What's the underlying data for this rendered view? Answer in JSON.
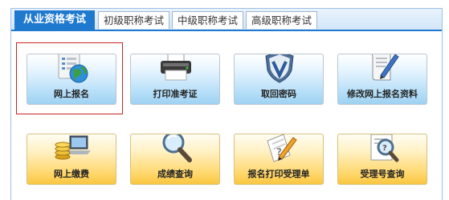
{
  "tabs": [
    {
      "label": "从业资格考试",
      "active": true
    },
    {
      "label": "初级职称考试",
      "active": false
    },
    {
      "label": "中级职称考试",
      "active": false
    },
    {
      "label": "高级职称考试",
      "active": false
    }
  ],
  "cards": [
    {
      "label": "网上报名",
      "icon": "document-globe-icon",
      "color": "blue"
    },
    {
      "label": "打印准考证",
      "icon": "printer-icon",
      "color": "blue"
    },
    {
      "label": "取回密码",
      "icon": "shield-icon",
      "color": "blue"
    },
    {
      "label": "修改网上报名资料",
      "icon": "scroll-pen-icon",
      "color": "blue"
    },
    {
      "label": "网上缴费",
      "icon": "coins-laptop-icon",
      "color": "orange"
    },
    {
      "label": "成绩查询",
      "icon": "magnifier-icon",
      "color": "orange"
    },
    {
      "label": "报名打印受理单",
      "icon": "pencil-paper-icon",
      "color": "orange"
    },
    {
      "label": "受理号查询",
      "icon": "search-document-icon",
      "color": "orange"
    }
  ],
  "colors": {
    "tab_active": "#1e79cf",
    "selection_border": "#cc2222"
  }
}
